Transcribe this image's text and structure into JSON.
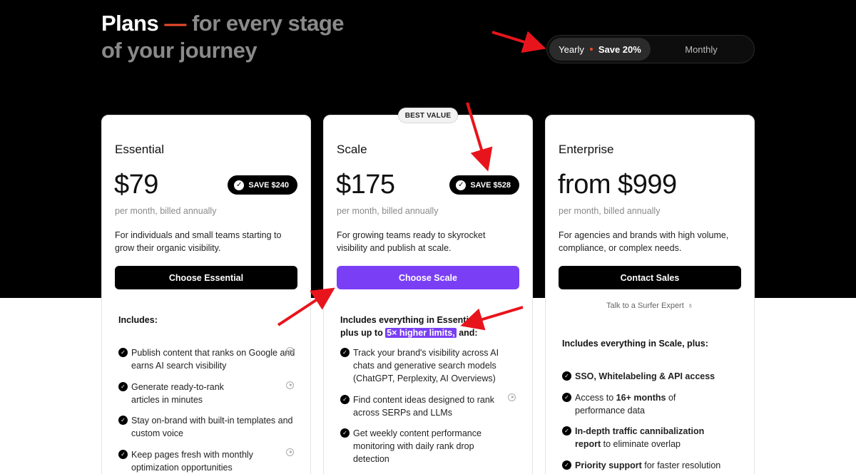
{
  "header": {
    "title_plans": "Plans",
    "title_dash": "—",
    "title_rest_line1": "for every stage",
    "title_rest_line2": "of your journey"
  },
  "billing": {
    "yearly_label": "Yearly",
    "yearly_save": "Save 20%",
    "monthly_label": "Monthly",
    "selected": "yearly"
  },
  "plans": [
    {
      "name": "Essential",
      "price": "$79",
      "save_badge": "SAVE $240",
      "billing_note": "per month, billed annually",
      "description": "For individuals and small teams starting to grow their organic visibility.",
      "cta": "Choose Essential",
      "includes_heading": "Includes:",
      "features": [
        "Publish content that ranks on Google and earns AI search visibility",
        "Generate ready-to-rank articles in minutes",
        "Stay on-brand with built-in templates and custom voice",
        "Keep pages fresh with monthly optimization opportunities"
      ]
    },
    {
      "name": "Scale",
      "badge": "BEST VALUE",
      "price": "$175",
      "save_badge": "SAVE $528",
      "billing_note": "per month, billed annually",
      "description": "For growing teams ready to skyrocket visibility and publish at scale.",
      "cta": "Choose Scale",
      "includes_line1": "Includes everything in Essential,",
      "includes_prefix": "plus up to",
      "includes_highlight": "5× higher limits,",
      "includes_suffix": "and:",
      "features": [
        "Track your brand's visibility across AI chats and generative search models (ChatGPT, Perplexity, AI Overviews)",
        "Find content ideas designed to rank across SERPs and LLMs",
        "Get weekly content performance monitoring with daily rank drop detection"
      ]
    },
    {
      "name": "Enterprise",
      "price": "from $999",
      "billing_note": "per month, billed annually",
      "description": "For agencies and brands with high volume, compliance, or complex needs.",
      "cta": "Contact Sales",
      "talk_link": "Talk to a Surfer Expert",
      "includes_heading": "Includes everything in Scale, plus:",
      "features": [
        {
          "bold": "SSO, Whitelabeling & API access",
          "rest": ""
        },
        {
          "pre": "Access to ",
          "bold": "16+ months",
          "rest": " of performance data"
        },
        {
          "bold": "In-depth traffic cannibalization report",
          "rest": " to eliminate overlap"
        },
        {
          "bold": "Priority support",
          "rest": " for faster resolution"
        }
      ]
    }
  ],
  "colors": {
    "accent_violet": "#7a3ff5",
    "dash_red": "#ee4b2b",
    "annotation_red": "#e8141c"
  },
  "icons": {
    "check": "check-circle-icon",
    "play": "play-circle-icon",
    "talk": "award-icon"
  }
}
